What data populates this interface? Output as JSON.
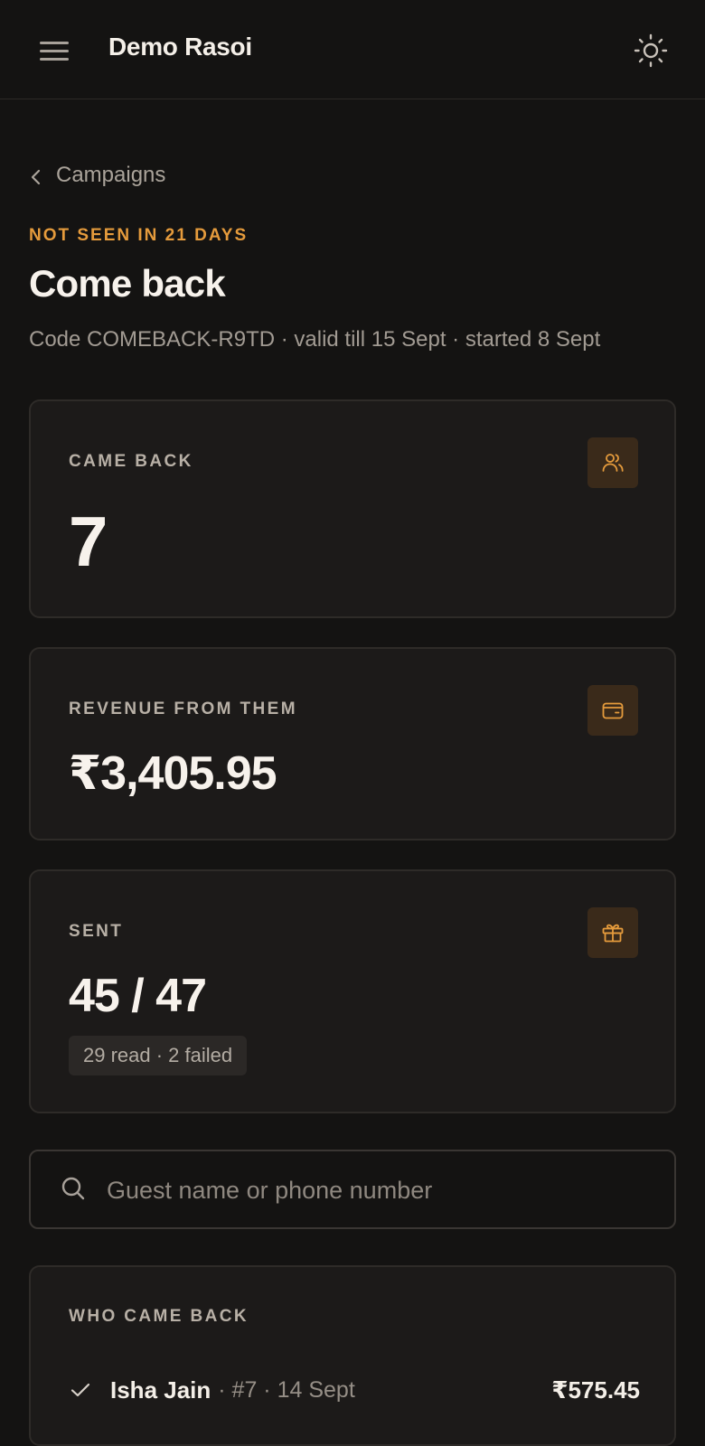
{
  "app": {
    "title": "Demo Rasoi"
  },
  "nav": {
    "back_label": "Campaigns"
  },
  "campaign": {
    "eyebrow": "NOT SEEN IN 21 DAYS",
    "title": "Come back",
    "meta": "Code COMEBACK-R9TD · valid till 15 Sept · started 8 Sept"
  },
  "stats": [
    {
      "label": "CAME BACK",
      "value": "7",
      "icon": "users-icon"
    },
    {
      "label": "REVENUE FROM THEM",
      "value": "₹3,405.95",
      "icon": "wallet-icon"
    },
    {
      "label": "SENT",
      "value": "45 / 47",
      "sub": "29 read · 2 failed",
      "icon": "gift-icon"
    }
  ],
  "search": {
    "placeholder": "Guest name or phone number",
    "value": ""
  },
  "returns": {
    "title": "WHO CAME BACK",
    "rows": [
      {
        "name": "Isha Jain",
        "meta": "· #7 · 14 Sept",
        "amount": "₹575.45",
        "icon": "check-icon"
      }
    ]
  },
  "colors": {
    "background": "#141312",
    "card": "#1c1a19",
    "accent": "#e59b3c",
    "icon_tile": "#3a2a1a",
    "text_primary": "#f4efe8",
    "text_muted": "#a29b93"
  }
}
